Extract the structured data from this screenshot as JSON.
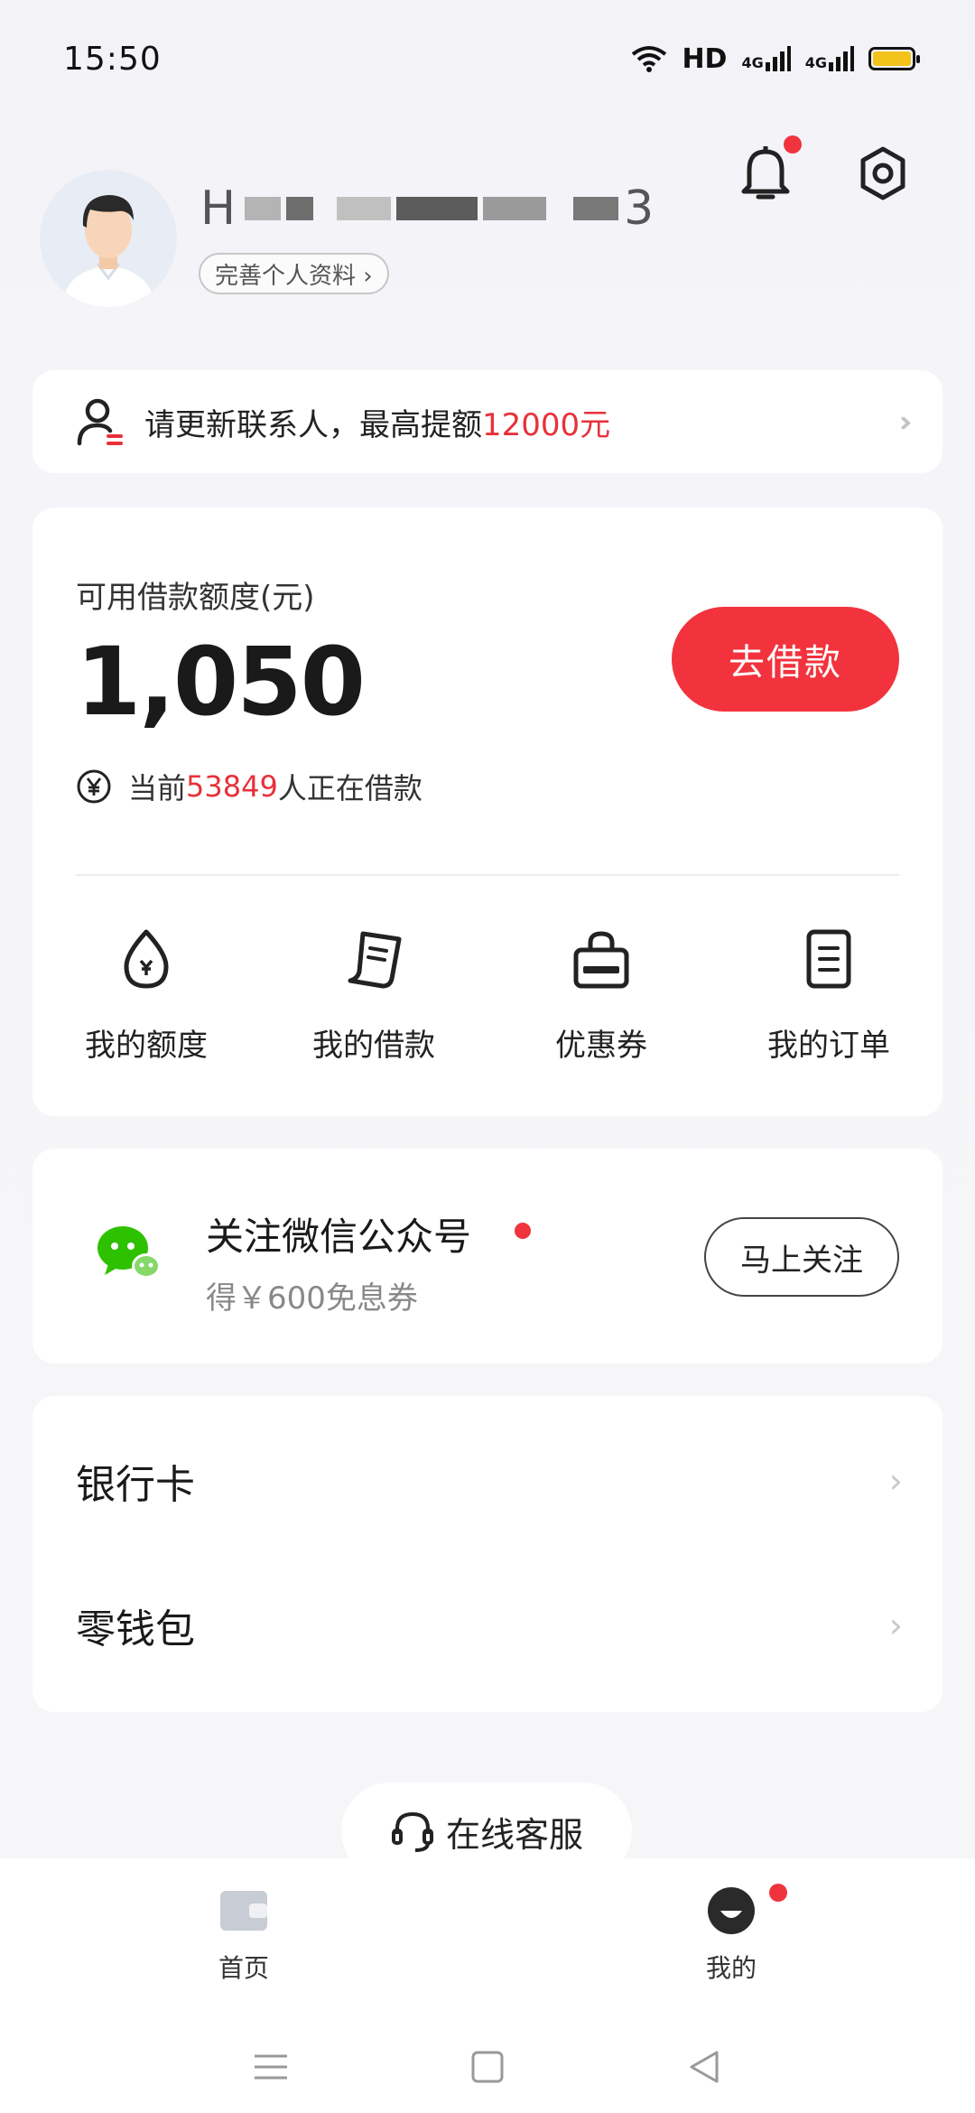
{
  "status_bar": {
    "time": "15:50",
    "network_label": "HD",
    "signal1": "4G",
    "signal2": "4G"
  },
  "profile": {
    "name_visible": "H",
    "name_tail": "3",
    "complete_label": "完善个人资料 ›"
  },
  "notice": {
    "text_before": "请更新联系人，最高提额",
    "amount": "12000元",
    "arrows": "›››"
  },
  "credit": {
    "label": "可用借款额度(元)",
    "amount": "1,050",
    "borrow_button": "去借款",
    "active_prefix": "当前",
    "active_count": "53849",
    "active_suffix": "人正在借款"
  },
  "shortcuts": [
    {
      "label": "我的额度",
      "icon": "drop-yen-icon"
    },
    {
      "label": "我的借款",
      "icon": "receipt-icon"
    },
    {
      "label": "优惠券",
      "icon": "bag-icon"
    },
    {
      "label": "我的订单",
      "icon": "document-icon"
    }
  ],
  "wechat": {
    "title": "关注微信公众号",
    "subtitle": "得￥600免息券",
    "follow_button": "马上关注"
  },
  "menu": [
    {
      "label": "银行卡"
    },
    {
      "label": "零钱包"
    }
  ],
  "service": {
    "label": "在线客服"
  },
  "tabbar": [
    {
      "label": "首页",
      "icon": "wallet-icon"
    },
    {
      "label": "我的",
      "icon": "smile-user-icon"
    }
  ],
  "colors": {
    "accent": "#f2333d",
    "highlight": "#e8313a",
    "wechat_green": "#2dc100"
  }
}
